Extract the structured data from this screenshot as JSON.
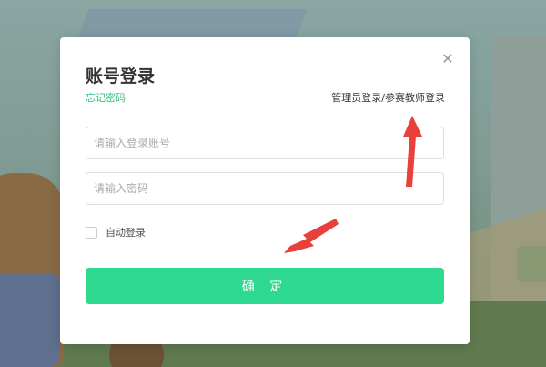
{
  "modal": {
    "title": "账号登录",
    "forgot_password": "忘记密码",
    "admin_login": "管理员登录/参赛教师登录",
    "close_icon": "close-icon"
  },
  "form": {
    "account_placeholder": "请输入登录账号",
    "password_placeholder": "请输入密码",
    "auto_login_label": "自动登录",
    "auto_login_checked": false,
    "submit_label": "确 定"
  },
  "colors": {
    "accent": "#2ed88f",
    "link_green": "#2ec27e",
    "annotation_red": "#e8403a"
  },
  "annotations": {
    "icon": "red-arrow-icon"
  }
}
